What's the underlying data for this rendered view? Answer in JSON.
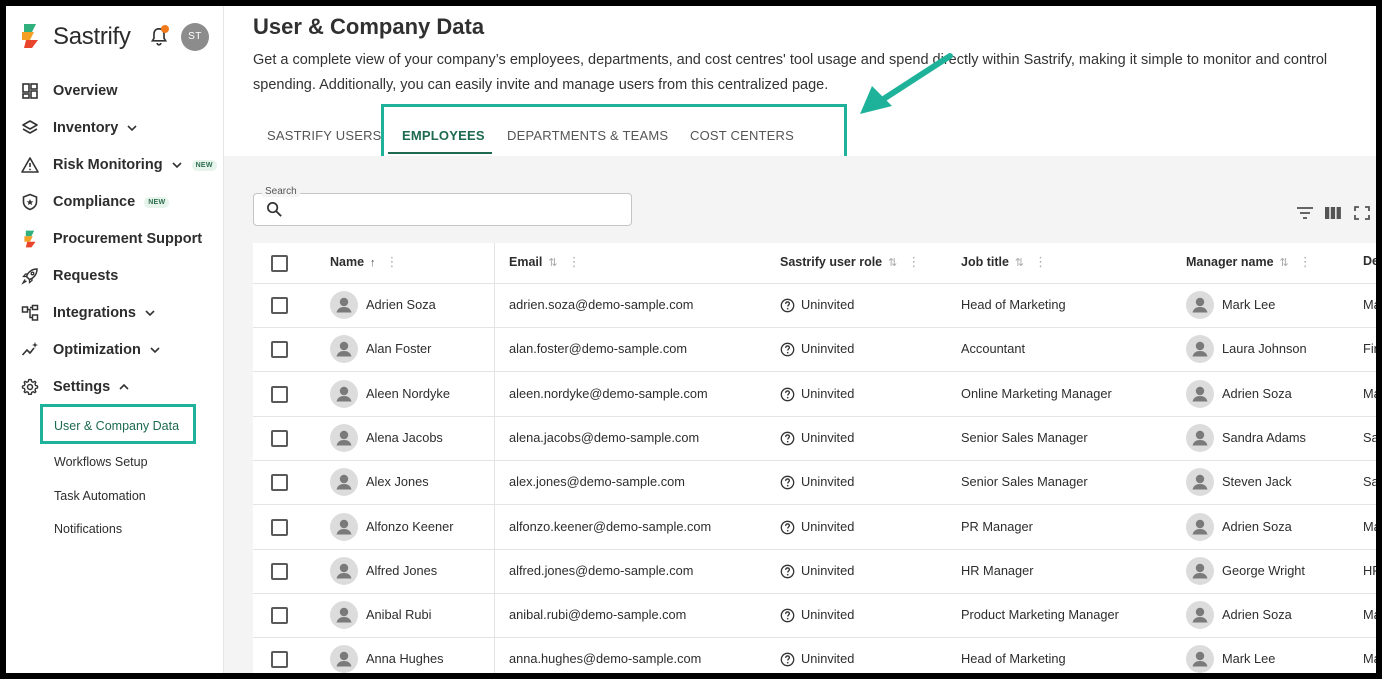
{
  "app": {
    "name": "Sastrify",
    "user_initials": "ST"
  },
  "sidebar": {
    "items": [
      {
        "label": "Overview",
        "icon": "dashboard-icon",
        "chevron": false,
        "badge": ""
      },
      {
        "label": "Inventory",
        "icon": "layers-icon",
        "chevron": true,
        "badge": ""
      },
      {
        "label": "Risk Monitoring",
        "icon": "warning-icon",
        "chevron": true,
        "badge": "NEW"
      },
      {
        "label": "Compliance",
        "icon": "shield-icon",
        "chevron": false,
        "badge": "NEW"
      },
      {
        "label": "Procurement Support",
        "icon": "sastrify-leaf-icon",
        "chevron": false,
        "badge": ""
      },
      {
        "label": "Requests",
        "icon": "rocket-icon",
        "chevron": false,
        "badge": ""
      },
      {
        "label": "Integrations",
        "icon": "integrations-icon",
        "chevron": true,
        "badge": ""
      },
      {
        "label": "Optimization",
        "icon": "sparkle-chart-icon",
        "chevron": true,
        "badge": ""
      },
      {
        "label": "Settings",
        "icon": "gear-icon",
        "chevron": true,
        "badge": ""
      }
    ],
    "settings_sub": [
      "User & Company Data",
      "Workflows Setup",
      "Task Automation",
      "Notifications"
    ]
  },
  "header": {
    "title": "User & Company Data",
    "description": "Get a complete view of your company’s employees, departments, and cost centres' tool usage and spend directly within Sastrify, making it simple to monitor and control spending. Additionally, you can easily invite and manage users from this centralized page."
  },
  "tabs": [
    "SASTRIFY USERS",
    "EMPLOYEES",
    "DEPARTMENTS & TEAMS",
    "COST CENTERS"
  ],
  "active_tab": "EMPLOYEES",
  "search": {
    "label": "Search",
    "placeholder": "",
    "value": ""
  },
  "table": {
    "columns": [
      "Name",
      "Email",
      "Sastrify user role",
      "Job title",
      "Manager name",
      "De"
    ],
    "rows": [
      {
        "name": "Adrien Soza",
        "email": "adrien.soza@demo-sample.com",
        "role": "Uninvited",
        "job": "Head of Marketing",
        "manager": "Mark Lee",
        "dept": "Ma"
      },
      {
        "name": "Alan Foster",
        "email": "alan.foster@demo-sample.com",
        "role": "Uninvited",
        "job": "Accountant",
        "manager": "Laura Johnson",
        "dept": "Fin"
      },
      {
        "name": "Aleen Nordyke",
        "email": "aleen.nordyke@demo-sample.com",
        "role": "Uninvited",
        "job": "Online Marketing Manager",
        "manager": "Adrien Soza",
        "dept": "Ma"
      },
      {
        "name": "Alena Jacobs",
        "email": "alena.jacobs@demo-sample.com",
        "role": "Uninvited",
        "job": "Senior Sales Manager",
        "manager": "Sandra Adams",
        "dept": "Sa"
      },
      {
        "name": "Alex Jones",
        "email": "alex.jones@demo-sample.com",
        "role": "Uninvited",
        "job": "Senior Sales Manager",
        "manager": "Steven Jack",
        "dept": "Sa"
      },
      {
        "name": "Alfonzo Keener",
        "email": "alfonzo.keener@demo-sample.com",
        "role": "Uninvited",
        "job": "PR Manager",
        "manager": "Adrien Soza",
        "dept": "Ma"
      },
      {
        "name": "Alfred Jones",
        "email": "alfred.jones@demo-sample.com",
        "role": "Uninvited",
        "job": "HR Manager",
        "manager": "George Wright",
        "dept": "HR"
      },
      {
        "name": "Anibal Rubi",
        "email": "anibal.rubi@demo-sample.com",
        "role": "Uninvited",
        "job": "Product Marketing Manager",
        "manager": "Adrien Soza",
        "dept": "Ma"
      },
      {
        "name": "Anna Hughes",
        "email": "anna.hughes@demo-sample.com",
        "role": "Uninvited",
        "job": "Head of Marketing",
        "manager": "Mark Lee",
        "dept": "Ma"
      }
    ]
  },
  "colors": {
    "accent": "#1d6a51",
    "highlight": "#1fb29a",
    "notification_dot": "#f07a1c"
  }
}
